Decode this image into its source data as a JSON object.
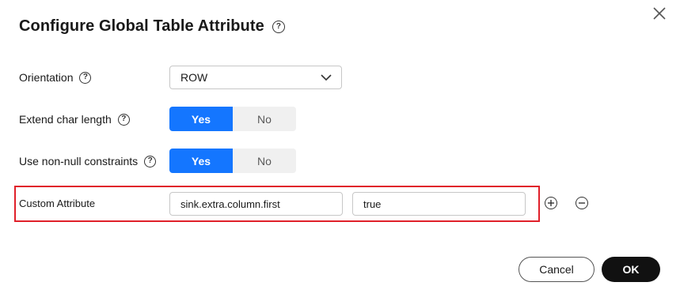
{
  "dialog": {
    "title": "Configure Global Table Attribute",
    "help_glyph": "?"
  },
  "fields": {
    "orientation": {
      "label": "Orientation",
      "value": "ROW"
    },
    "extend_char_length": {
      "label": "Extend char length",
      "yes": "Yes",
      "no": "No",
      "selected": "Yes"
    },
    "non_null": {
      "label": "Use non-null constraints",
      "yes": "Yes",
      "no": "No",
      "selected": "Yes"
    },
    "custom_attribute": {
      "label": "Custom Attribute",
      "key": "sink.extra.column.first",
      "value": "true"
    }
  },
  "footer": {
    "cancel_label": "Cancel",
    "ok_label": "OK"
  },
  "colors": {
    "primary": "#1476ff",
    "highlight": "#e0202a",
    "ok_button": "#111111"
  },
  "icons": [
    "help-icon",
    "close-icon",
    "chevron-down-icon",
    "add-circle-icon",
    "remove-circle-icon"
  ]
}
